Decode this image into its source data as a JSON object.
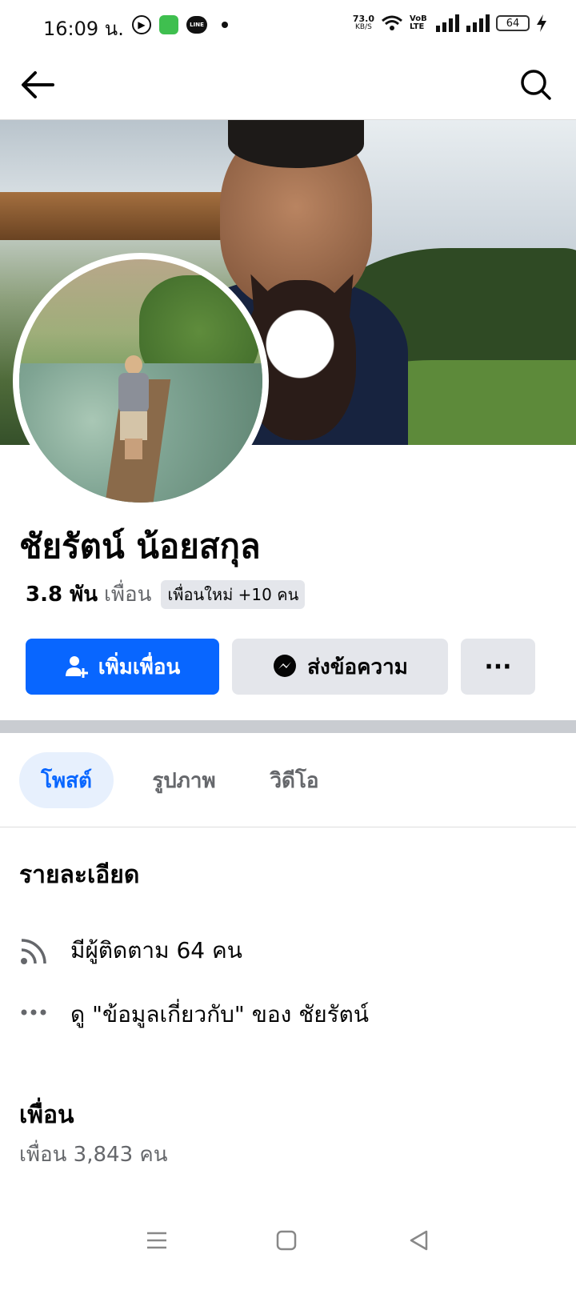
{
  "status_bar": {
    "time": "16:09 น.",
    "net_speed": "73.0",
    "net_unit": "KB/S",
    "volte": "VoB LTE",
    "battery": "64"
  },
  "profile": {
    "name": "ชัยรัตน์ น้อยสกุล",
    "friends_count": "3.8 พัน",
    "friends_word": "เพื่อน",
    "new_friends_badge": "เพื่อนใหม่ +10 คน"
  },
  "actions": {
    "add_friend": "เพิ่มเพื่อน",
    "message": "ส่งข้อความ",
    "more": "···"
  },
  "tabs": [
    {
      "label": "โพสต์",
      "active": true
    },
    {
      "label": "รูปภาพ",
      "active": false
    },
    {
      "label": "วิดีโอ",
      "active": false
    }
  ],
  "details": {
    "title": "รายละเอียด",
    "followers": "มีผู้ติดตาม 64 คน",
    "about": "ดู \"ข้อมูลเกี่ยวกับ\" ของ ชัยรัตน์"
  },
  "friends_section": {
    "title": "เพื่อน",
    "count": "เพื่อน 3,843 คน"
  },
  "colors": {
    "accent": "#0866ff",
    "secondary_button": "#e4e6eb",
    "muted_text": "#65676b"
  }
}
